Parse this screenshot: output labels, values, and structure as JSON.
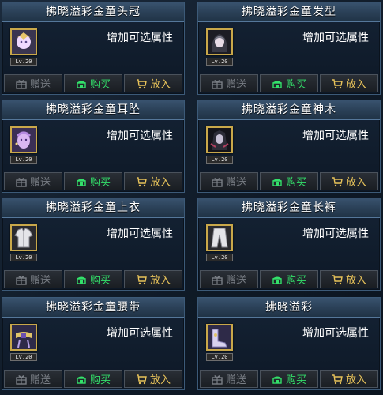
{
  "items": [
    {
      "title": "拂晓溢彩金童头冠",
      "desc": "增加可选属性",
      "level": "Lv.20",
      "icon": "head-crown-icon"
    },
    {
      "title": "拂晓溢彩金童发型",
      "desc": "增加可选属性",
      "level": "Lv.20",
      "icon": "hairstyle-icon"
    },
    {
      "title": "拂晓溢彩金童耳坠",
      "desc": "增加可选属性",
      "level": "Lv.20",
      "icon": "earring-face-icon"
    },
    {
      "title": "拂晓溢彩金童神木",
      "desc": "增加可选属性",
      "level": "Lv.20",
      "icon": "divine-wood-icon"
    },
    {
      "title": "拂晓溢彩金童上衣",
      "desc": "增加可选属性",
      "level": "Lv.20",
      "icon": "coat-icon"
    },
    {
      "title": "拂晓溢彩金童长裤",
      "desc": "增加可选属性",
      "level": "Lv.20",
      "icon": "pants-icon"
    },
    {
      "title": "拂晓溢彩金童腰带",
      "desc": "增加可选属性",
      "level": "Lv.20",
      "icon": "belt-icon"
    },
    {
      "title": "拂晓溢彩",
      "desc": "增加可选属性",
      "level": "Lv.20",
      "icon": "shoes-icon"
    }
  ],
  "buttons": {
    "gift": "赠送",
    "buy": "购买",
    "put": "放入"
  }
}
